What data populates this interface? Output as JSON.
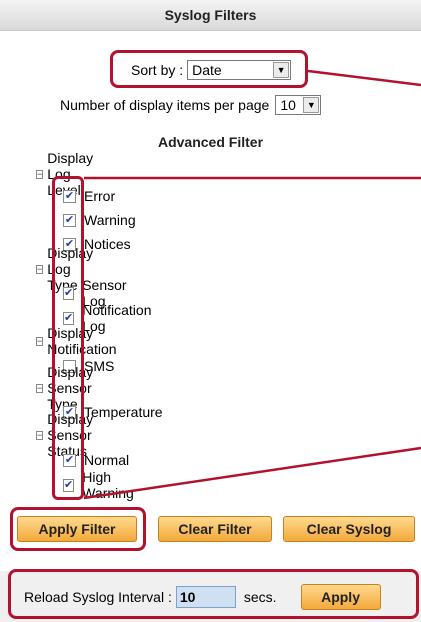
{
  "header": {
    "title": "Syslog Filters"
  },
  "sort": {
    "label": "Sort by :",
    "value": "Date"
  },
  "items_per_page": {
    "label": "Number of display items per page",
    "value": "10"
  },
  "advanced": {
    "title": "Advanced Filter"
  },
  "groups": [
    {
      "label": "Display Log Level",
      "items": [
        {
          "label": "Error",
          "checked": true
        },
        {
          "label": "Warning",
          "checked": true
        },
        {
          "label": "Notices",
          "checked": true
        }
      ]
    },
    {
      "label": "Display Log Type",
      "items": [
        {
          "label": "Sensor Log",
          "checked": true
        },
        {
          "label": "Notification Log",
          "checked": true
        }
      ]
    },
    {
      "label": "Display Notification",
      "items": [
        {
          "label": "SMS",
          "checked": false
        }
      ]
    },
    {
      "label": "Display Sensor Type",
      "items": [
        {
          "label": "Temperature",
          "checked": true
        }
      ]
    },
    {
      "label": "Display Sensor Status",
      "items": [
        {
          "label": "Normal",
          "checked": true
        },
        {
          "label": "High Warning",
          "checked": true
        }
      ]
    }
  ],
  "buttons": {
    "apply_filter": "Apply Filter",
    "clear_filter": "Clear Filter",
    "clear_syslog": "Clear Syslog"
  },
  "reload": {
    "label": "Reload Syslog Interval :",
    "value": "10",
    "unit": "secs.",
    "apply": "Apply"
  },
  "colors": {
    "highlight": "#b3122f",
    "button": "#f2a93b",
    "input": "#cfe0f3"
  }
}
